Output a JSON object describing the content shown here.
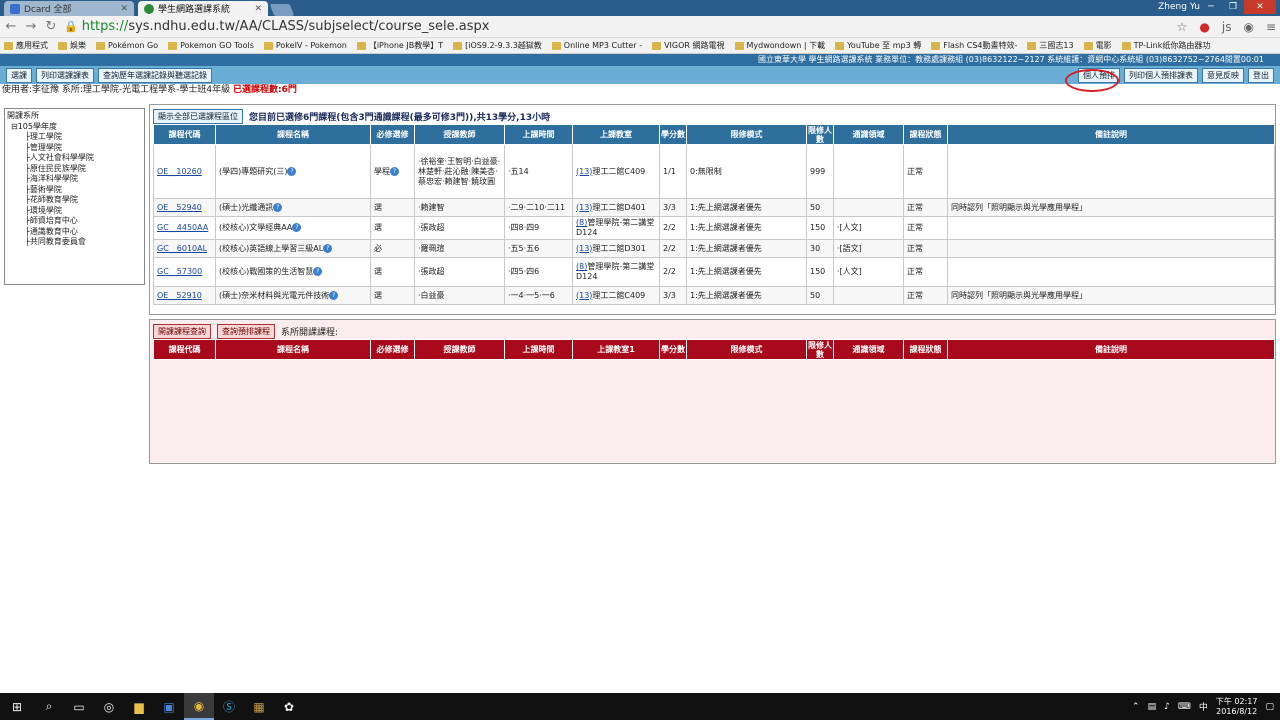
{
  "browser": {
    "tabs": [
      {
        "title": "Dcard 全部",
        "active": false,
        "color": "#3a6fd0"
      },
      {
        "title": "學生網路選課系統",
        "active": true,
        "color": "#2a8a3a"
      }
    ],
    "user": "Zheng Yu",
    "url_scheme": "https://",
    "url_rest": "sys.ndhu.edu.tw/AA/CLASS/subjselect/course_sele.aspx",
    "bookmarks": [
      "應用程式",
      "娛樂",
      "Pokémon Go",
      "Pokemon GO Tools",
      "PokeIV - Pokemon",
      "【iPhone JB教學】T",
      "[iOS9.2-9.3.3越獄教",
      "Online MP3 Cutter -",
      "VIGOR 網路電視",
      "Mydwondown | 下載",
      "YouTube 至 mp3 轉",
      "Flash CS4動畫特效-",
      "三國志13",
      "電影",
      "TP-Link纸你路由器功"
    ]
  },
  "site": {
    "banner": "國立東華大學 學生網路選課系統 業務單位：教務處課務組 (03)8632122~2127 系統維護：資網中心系統組 (03)8632752~2764閒置00:01",
    "toolbar_left": [
      "選課",
      "列印選課課表",
      "查詢歷年選課記錄與聽選記錄"
    ],
    "toolbar_right": [
      "個人預排",
      "列印個人預排課表",
      "意見反映",
      "登出"
    ],
    "user_line": "使用者:李征豫 系所:理工學院-光電工程學系-學士班4年級",
    "selected_count": "已選課程數:6門"
  },
  "tree": {
    "root": "開課系所",
    "year": "⊟105學年度",
    "colleges": [
      "理工學院",
      "管理學院",
      "人文社會科學學院",
      "原住民民族學院",
      "海洋科學學院",
      "藝術學院",
      "花師教育學院",
      "環境學院",
      "師資培育中心",
      "通識教育中心",
      "共同教育委員會"
    ]
  },
  "selected_panel": {
    "button": "顯示全部已選課程區位",
    "summary": "您目前已選修6門課程(包含3門通識課程(最多可修3門)),共13學分,13小時",
    "headers": [
      "課程代碼",
      "課程名稱",
      "必修選修",
      "授課教師",
      "上課時間",
      "上課教室",
      "學分數",
      "限修模式",
      "限修人數",
      "通識領域",
      "課程狀態",
      "備註說明"
    ],
    "rows": [
      {
        "code": "OE__10260",
        "name": "(學四)專題研究(三)",
        "req": "學程",
        "teacher": "·徐裕奎·王智明·白益豪·林楚軒·莊沁融·陳美杏·蔡忠宏·賴建智·饒玟圓",
        "time": "·五14",
        "room_num": "(13)",
        "room": "理工二館C409",
        "credit": "1/1",
        "mode": "0:無限制",
        "limit": "999",
        "gen": "",
        "status": "正常",
        "note": ""
      },
      {
        "code": "OE__52940",
        "name": "(碩士)光纖通訊",
        "req": "選",
        "teacher": "·賴建智",
        "time": "·二9·二10·二11",
        "room_num": "(13)",
        "room": "理工二館D401",
        "credit": "3/3",
        "mode": "1:先上網選課者優先",
        "limit": "50",
        "gen": "",
        "status": "正常",
        "note": "同時認列「照明顯示與光學應用學程」"
      },
      {
        "code": "GC__4450AA",
        "name": "(校核心)文學經典AA",
        "req": "選",
        "teacher": "·張政超",
        "time": "·四8·四9",
        "room_num": "(8)",
        "room": "管理學院-第二講堂D124",
        "credit": "2/2",
        "mode": "1:先上網選課者優先",
        "limit": "150",
        "gen": "·[人文]",
        "status": "正常",
        "note": ""
      },
      {
        "code": "GC__6010AL",
        "name": "(校核心)英語線上學習三級AL",
        "req": "必",
        "teacher": "·羅珮瑄",
        "time": "·五5·五6",
        "room_num": "(13)",
        "room": "理工二館D301",
        "credit": "2/2",
        "mode": "1:先上網選課者優先",
        "limit": "30",
        "gen": "·[語文]",
        "status": "正常",
        "note": ""
      },
      {
        "code": "GC__57300",
        "name": "(校核心)戰國策的生活智慧",
        "req": "選",
        "teacher": "·張政超",
        "time": "·四5·四6",
        "room_num": "(8)",
        "room": "管理學院-第二講堂D124",
        "credit": "2/2",
        "mode": "1:先上網選課者優先",
        "limit": "150",
        "gen": "·[人文]",
        "status": "正常",
        "note": ""
      },
      {
        "code": "OE__52910",
        "name": "(碩士)奈米材料與光電元件技術",
        "req": "選",
        "teacher": "·白益豪",
        "time": "·一4·一5·一6",
        "room_num": "(13)",
        "room": "理工二館C409",
        "credit": "3/3",
        "mode": "1:先上網選課者優先",
        "limit": "50",
        "gen": "",
        "status": "正常",
        "note": "同時認列「照明顯示與光學應用學程」"
      }
    ]
  },
  "open_panel": {
    "btn_query": "開課課程查詢",
    "btn_prelist": "查詢預排課程",
    "label": "系所開課課程:",
    "headers": [
      "課程代碼",
      "課程名稱",
      "必修選修",
      "授課教師",
      "上課時間",
      "上課教室1",
      "學分數",
      "限修模式",
      "限修人數",
      "通識領域",
      "課程狀態",
      "備註說明"
    ]
  },
  "taskbar": {
    "clock_time": "下午 02:17",
    "clock_date": "2016/8/12"
  }
}
